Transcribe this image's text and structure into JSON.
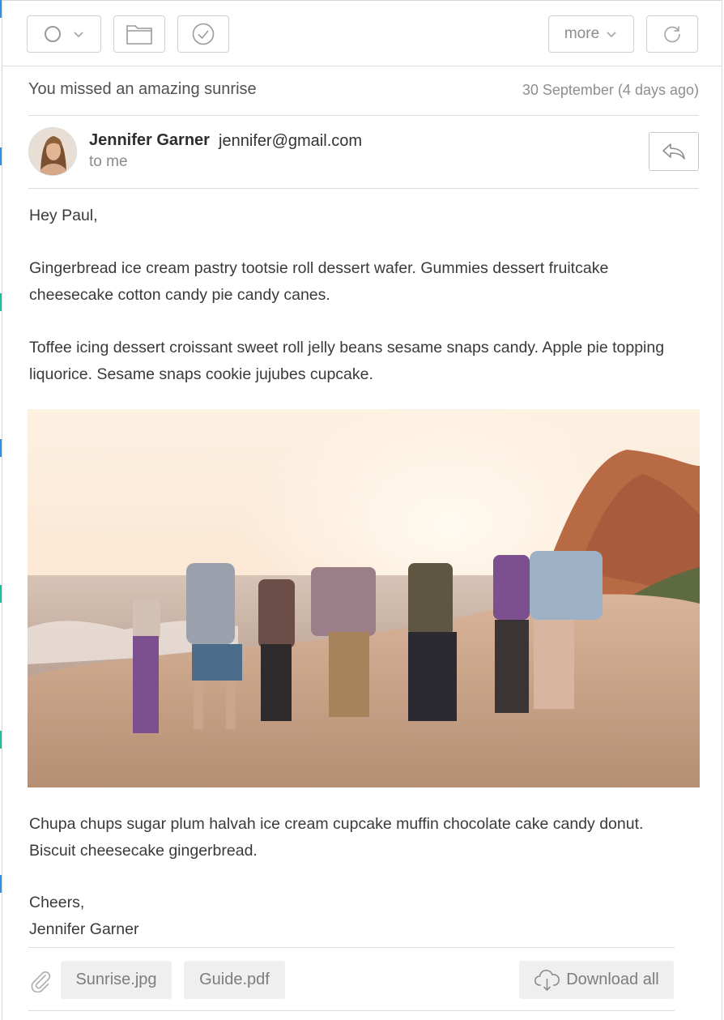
{
  "toolbar": {
    "status_icon": "circle-icon",
    "dropdown_icon": "chevron-down-icon",
    "folder_icon": "folder-icon",
    "done_icon": "check-circle-icon",
    "more_label": "more",
    "refresh_icon": "refresh-icon"
  },
  "message": {
    "subject": "You missed an amazing sunrise",
    "date": "30 September (4 days ago)",
    "sender_name": "Jennifer Garner",
    "sender_email": "jennifer@gmail.com",
    "recipient": "to me",
    "reply_icon": "reply-icon",
    "greeting": "Hey Paul,",
    "paragraph1": "Gingerbread ice cream pastry tootsie roll dessert wafer. Gummies dessert fruitcake cheesecake cotton candy pie candy canes.",
    "paragraph2": "Toffee icing dessert croissant sweet roll jelly beans sesame snaps candy. Apple pie topping liquorice. Sesame snaps cookie jujubes cupcake.",
    "image_description": "beach-sunset-photo",
    "paragraph3": "Chupa chups sugar plum halvah ice cream cupcake muffin chocolate cake candy donut. Biscuit cheesecake gingerbread.",
    "signoff": "Cheers,",
    "signature": "Jennifer Garner"
  },
  "attachments": {
    "icon": "paperclip-icon",
    "files": [
      "Sunrise.jpg",
      "Guide.pdf"
    ],
    "download_all_label": "Download all",
    "download_icon": "cloud-download-icon"
  },
  "colors": {
    "border": "#d0d0d0",
    "chip_bg": "#efefef",
    "edge_blue": "#2f8fe0",
    "edge_teal": "#1bbf9b"
  }
}
